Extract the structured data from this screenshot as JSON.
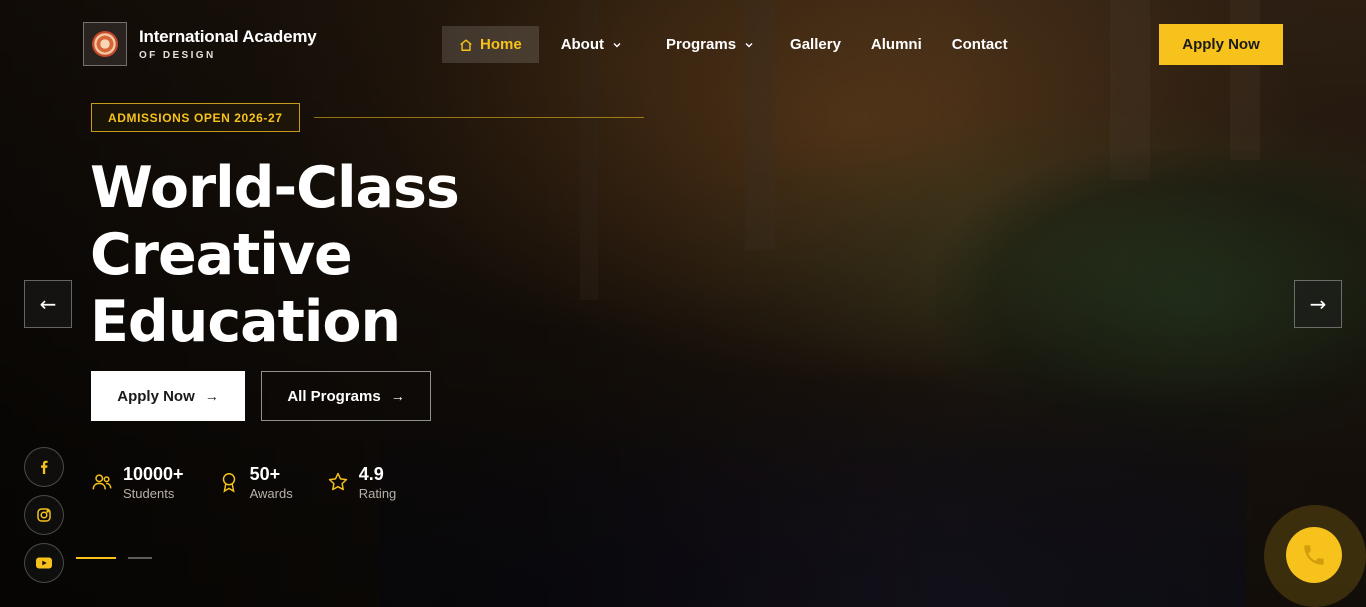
{
  "brand": {
    "name": "International Academy",
    "subtitle": "OF DESIGN",
    "logo_icon": "academy-seal-icon"
  },
  "nav": {
    "items": [
      {
        "label": "Home",
        "active": true,
        "icon": "home-icon"
      },
      {
        "label": "About",
        "dropdown": true
      },
      {
        "label": "Programs",
        "dropdown": true
      },
      {
        "label": "Gallery"
      },
      {
        "label": "Alumni"
      },
      {
        "label": "Contact"
      }
    ],
    "cta_label": "Apply Now"
  },
  "hero": {
    "badge": "ADMISSIONS OPEN 2026-27",
    "headline_line1": "World-Class",
    "headline_line2": "Creative",
    "headline_line3": "Education",
    "primary_cta": "Apply Now",
    "secondary_cta": "All Programs",
    "stats": [
      {
        "value": "10000+",
        "label": "Students",
        "icon": "users-icon"
      },
      {
        "value": "50+",
        "label": "Awards",
        "icon": "award-icon"
      },
      {
        "value": "4.9",
        "label": "Rating",
        "icon": "star-icon"
      }
    ]
  },
  "carousel": {
    "prev_icon": "arrow-left-icon",
    "next_icon": "arrow-right-icon",
    "active_slide": 1,
    "total_slides": 2
  },
  "socials": [
    "facebook-icon",
    "instagram-icon",
    "youtube-icon"
  ],
  "floating": {
    "icon": "phone-icon"
  },
  "colors": {
    "accent": "#f6c21b",
    "background": "#1d150e"
  }
}
